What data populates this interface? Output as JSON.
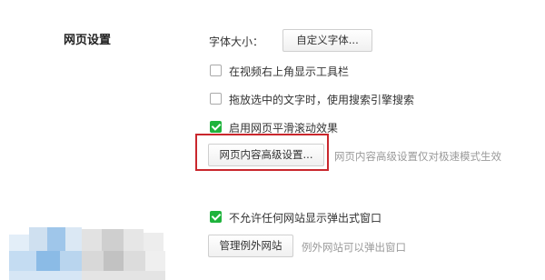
{
  "section": {
    "title": "网页设置"
  },
  "font": {
    "label": "字体大小：",
    "custom_button": "自定义字体..."
  },
  "options": [
    {
      "label": "在视频右上角显示工具栏",
      "checked": false
    },
    {
      "label": "拖放选中的文字时，使用搜索引擎搜索",
      "checked": false
    },
    {
      "label": "启用网页平滑滚动效果",
      "checked": true
    }
  ],
  "advanced": {
    "button": "网页内容高级设置...",
    "hint": "网页内容高级设置仅对极速模式生效"
  },
  "popup": {
    "label": "不允许任何网站显示弹出式窗口",
    "checked": true,
    "manage_button": "管理例外网站",
    "hint": "例外网站可以弹出窗口"
  },
  "colors": {
    "check_green": "#1fb33c",
    "highlight_red": "#c9272d",
    "hint_gray": "#9a9a9a"
  }
}
